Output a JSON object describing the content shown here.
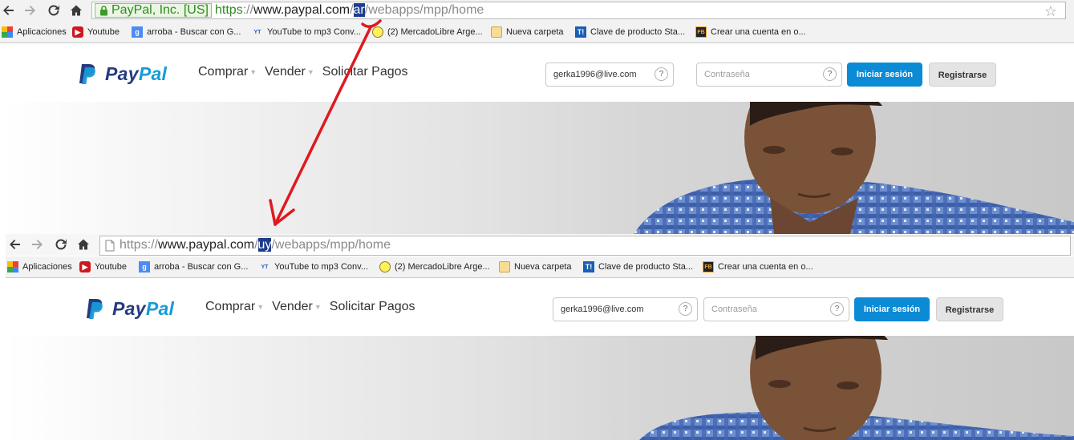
{
  "screens": [
    {
      "nav": {
        "back": "back-arrow",
        "forward": "forward-arrow",
        "reload": "reload",
        "home": "home"
      },
      "address": {
        "ev_label": "PayPal, Inc. [US]",
        "scheme": "https",
        "scheme_sep": "://",
        "host": "www.paypal.com",
        "slash": "/",
        "country": "ar",
        "path": "/webapps/mpp/home"
      },
      "bookmarks": [
        {
          "label": "Aplicaciones",
          "icon": "apps-grid-icon"
        },
        {
          "label": "Youtube",
          "icon": "youtube-icon"
        },
        {
          "label": "arroba - Buscar con G...",
          "icon": "google-icon"
        },
        {
          "label": "YouTube to mp3 Conv...",
          "icon": "yt-mp3-icon"
        },
        {
          "label": "(2) MercadoLibre Arge...",
          "icon": "mercadolibre-icon"
        },
        {
          "label": "Nueva carpeta",
          "icon": "folder-icon"
        },
        {
          "label": "Clave de producto Sta...",
          "icon": "t-icon"
        },
        {
          "label": "Crear una cuenta en o...",
          "icon": "fb-icon"
        }
      ],
      "paypal": {
        "logo_pay": "Pay",
        "logo_pal": "Pal",
        "nav": [
          "Comprar",
          "Vender",
          "Solicitar Pagos"
        ],
        "email_value": "gerka1996@live.com",
        "password_placeholder": "Contraseña",
        "help": "?",
        "login_button": "Iniciar sesión",
        "register_button": "Registrarse"
      }
    },
    {
      "nav": {
        "back": "back-arrow",
        "forward": "forward-arrow",
        "reload": "reload",
        "home": "home"
      },
      "address": {
        "scheme": "https",
        "scheme_sep": "://",
        "host": "www.paypal.com",
        "slash": "/",
        "country": "uy",
        "path": "/webapps/mpp/home"
      },
      "bookmarks": [
        {
          "label": "Aplicaciones",
          "icon": "apps-grid-icon"
        },
        {
          "label": "Youtube",
          "icon": "youtube-icon"
        },
        {
          "label": "arroba - Buscar con G...",
          "icon": "google-icon"
        },
        {
          "label": "YouTube to mp3 Conv...",
          "icon": "yt-mp3-icon"
        },
        {
          "label": "(2) MercadoLibre Arge...",
          "icon": "mercadolibre-icon"
        },
        {
          "label": "Nueva carpeta",
          "icon": "folder-icon"
        },
        {
          "label": "Clave de producto Sta...",
          "icon": "t-icon"
        },
        {
          "label": "Crear una cuenta en o...",
          "icon": "fb-icon"
        }
      ],
      "paypal": {
        "logo_pay": "Pay",
        "logo_pal": "Pal",
        "nav": [
          "Comprar",
          "Vender",
          "Solicitar Pagos"
        ],
        "email_value": "gerka1996@live.com",
        "password_placeholder": "Contraseña",
        "help": "?",
        "login_button": "Iniciar sesión",
        "register_button": "Registrarse"
      }
    }
  ],
  "annotation": {
    "arrow_color": "#e0191e",
    "description": "red arrow from ar to uy"
  },
  "colors": {
    "paypal_dark": "#253b80",
    "paypal_light": "#179bd7",
    "login_blue": "#0b8ad6",
    "ev_green": "#2e8b1e",
    "highlight": "#1c3b8c"
  }
}
